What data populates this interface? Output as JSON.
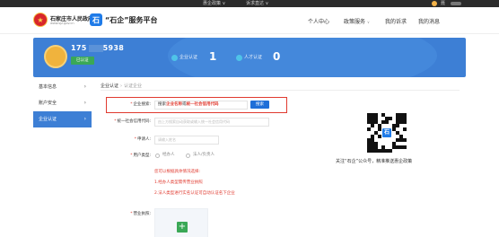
{
  "topbar": {
    "link1": "惠企政策",
    "link1_chevron": "∨",
    "link2": "诉求直达",
    "link2_chevron": "∨",
    "user_initial": "聂"
  },
  "header": {
    "gov_name": "石家庄市人民政府",
    "gov_url": "www.sjz.gov.cn",
    "brand_logo_text": "石",
    "brand_title": "“石企”服务平台",
    "nav": [
      "个人中心",
      "政策服务",
      "我的诉求",
      "我的消息"
    ],
    "nav_chevron": "∨"
  },
  "banner": {
    "phone_prefix": "175",
    "phone_suffix": "5938",
    "badge": "已认证",
    "enterprise_label": "企业认证",
    "enterprise_count": "1",
    "talent_label": "人才认证",
    "talent_count": "0"
  },
  "sidebar": {
    "items": [
      {
        "label": "基本信息",
        "arrow": "›"
      },
      {
        "label": "账户安全",
        "arrow": "›"
      },
      {
        "label": "企业认证",
        "arrow": "›"
      }
    ]
  },
  "breadcrumb": {
    "root": "企业认证",
    "sep": "›",
    "current": "认证企业"
  },
  "form": {
    "search_label": "企业搜索:",
    "search_prefix": "搜索",
    "search_highlight": "企业名称",
    "search_mid": "或",
    "search_highlight2": "统一社会信用代码",
    "search_button": "搜索",
    "credit_label": "统一社会信用代码:",
    "credit_placeholder": "由上方搜索自动获取或输入统一社会信用代码",
    "applicant_label": "申请人:",
    "applicant_placeholder": "请输入姓名",
    "user_type_label": "用户类型:",
    "type_options": [
      "经办人",
      "法人/负责人"
    ],
    "notes": [
      "您可以根据具体情况选择:",
      "1.经办人类型需传营业执照",
      "2.法人类型进行实名认证可自动认证名下企业"
    ],
    "license_label": "营业执照:",
    "upload_plus": "+"
  },
  "qr": {
    "center_text": "石",
    "caption": "关注“石企”公众号，精准推送惠企政策"
  },
  "colors": {
    "primary": "#3d7fd5",
    "accent_red": "#e03a2f",
    "badge_green": "#3aa856",
    "topbar": "#2b2b2b"
  },
  "icons": [
    "emblem-icon",
    "brand-logo-icon",
    "avatar-icon",
    "enterprise-icon",
    "talent-icon",
    "chevron-right-icon",
    "upload-plus-icon",
    "qr-code-icon"
  ]
}
